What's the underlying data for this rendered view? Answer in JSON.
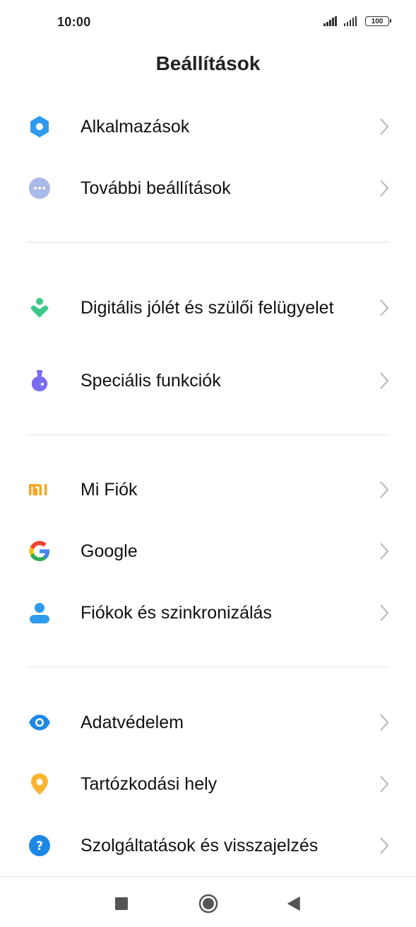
{
  "status_bar": {
    "time": "10:00",
    "battery": "100"
  },
  "header": {
    "title": "Beállítások"
  },
  "items": [
    {
      "label": "Alkalmazások",
      "icon": "gear-icon",
      "color": "#2e9bf0"
    },
    {
      "label": "További beállítások",
      "icon": "more-dots-icon",
      "color": "#a9b9e8"
    },
    {
      "label": "Digitális jólét és szülői felügyelet",
      "icon": "digital-wellbeing-icon",
      "color": "#3cc88c"
    },
    {
      "label": "Speciális funkciók",
      "icon": "flask-icon",
      "color": "#7a6cf5"
    },
    {
      "label": "Mi Fiók",
      "icon": "mi-logo-icon",
      "color": "#f5a623"
    },
    {
      "label": "Google",
      "icon": "google-logo-icon",
      "color": "#4285f4"
    },
    {
      "label": "Fiókok és szinkronizálás",
      "icon": "person-icon",
      "color": "#2e9bf0"
    },
    {
      "label": "Adatvédelem",
      "icon": "eye-icon",
      "color": "#1e88e5"
    },
    {
      "label": "Tartózkodási hely",
      "icon": "location-pin-icon",
      "color": "#f9b530"
    },
    {
      "label": "Szolgáltatások és visszajelzés",
      "icon": "help-question-icon",
      "color": "#1e88e5"
    }
  ],
  "nav": {
    "recents": "recents-square-icon",
    "home": "home-circle-icon",
    "back": "back-triangle-icon"
  }
}
